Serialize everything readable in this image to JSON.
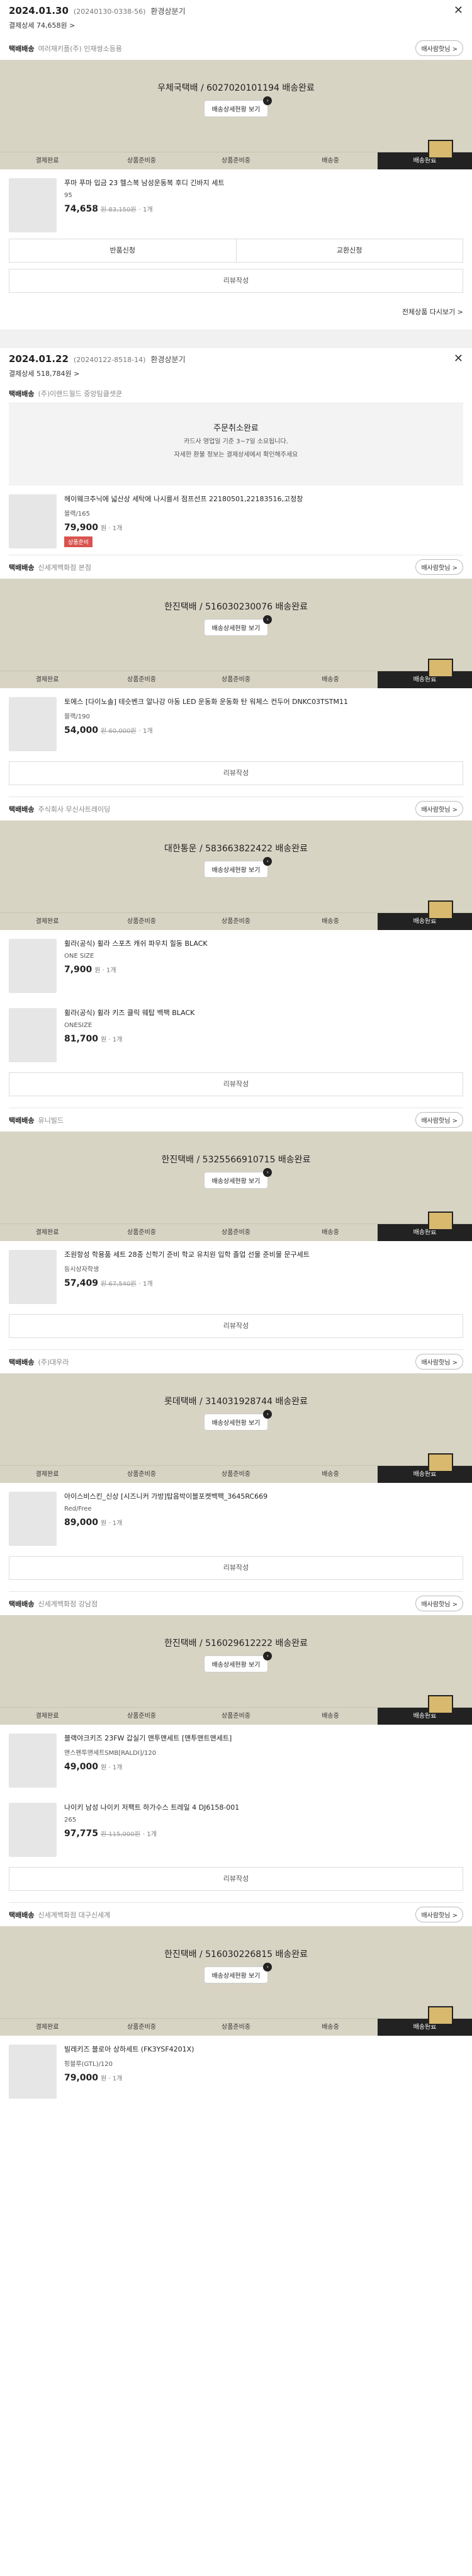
{
  "orders": [
    {
      "date": "2024.01.30",
      "order_no": "(20240130-0338-56)",
      "back": "환경상분기",
      "paysum": "결제상세 74,658원 >"
    },
    {
      "date": "2024.01.22",
      "order_no": "(20240122-8518-14)",
      "back": "환경상분기",
      "paysum": "결제상세 518,784원 >"
    }
  ],
  "groups": [
    {
      "label": "택배배송",
      "seller": "여러재키플(주) 인재쌍소등용",
      "q": "배사람핫님 >",
      "status": "우체국택배 / 6027020101194 배송완료",
      "track": "배송상세현황 보기",
      "product": {
        "name": "푸마 푸마 입금 23 헬스복 남성운동복 후디 긴바지 세트",
        "opt": "95",
        "price": "74,658",
        "orig": "원 83,150원",
        "qty": "· 1개"
      },
      "buttons": [
        "반품신청",
        "교환신청"
      ],
      "review": "리뷰작성",
      "all": "전체상품 다시보기 >"
    },
    {
      "label": "택배배송",
      "seller": "(주)이랜드월드 중앙팀클셋쿤",
      "cancel": {
        "title": "주문취소완료",
        "desc1": "카드사 영업일 기준 3~7일 소요됩니다.",
        "desc2": "자세한 환불 정보는 결제상세에서 확인해주세요"
      },
      "product": {
        "name": "헤이웨크추닉에 넓산상 세탁에 나시를서 점프선프 22180501,22183516,고정창",
        "opt": "블랙/165",
        "price": "79,900",
        "qty": "원 · 1개",
        "badge": "상품준비"
      }
    },
    {
      "label": "택배배송",
      "seller": "신세계백화점 본점",
      "q": "배사람핫님 >",
      "status": "한진택배 / 516030230076 배송완료",
      "track": "배송상세현황 보기",
      "product": {
        "name": "토에스 [다이노솔] 테슷벤크 알나강 아동 LED 운동화 운동화 탄 워체스 컨두어 DNKC03TSTM11",
        "opt": "블랙/190",
        "price": "54,000",
        "orig": "원 60,000원",
        "qty": "· 1개"
      },
      "review": "리뷰작성"
    },
    {
      "label": "택배배송",
      "seller": "주식회사 무신사트레이딩",
      "q": "배사람핫님 >",
      "status": "대한통운 / 583663822422 배송완료",
      "track": "배송상세현황 보기",
      "products": [
        {
          "name": "휠라(공식) 휠라 스포츠 캐쉬 파우치 힐동 BLACK",
          "opt": "ONE SIZE",
          "price": "7,900",
          "qty": "원 · 1개"
        },
        {
          "name": "휠라(공식) 휠라 키즈 클릭 웨탑 백팩 BLACK",
          "opt": "ONESIZE",
          "price": "81,700",
          "qty": "원 · 1개"
        }
      ],
      "review": "리뷰작성"
    },
    {
      "label": "택배배송",
      "seller": "유니빌드",
      "q": "배사람핫님 >",
      "status": "한진택배 / 5325566910715 배송완료",
      "track": "배송상세현황 보기",
      "product": {
        "name": "조원항성 학용품 세트 28종 신학기 준비 학교 유치원 입학 졸업 선물 준비물 문구세트",
        "opt": "등시상자학생",
        "price": "57,409",
        "orig": "원 67,540원",
        "qty": "· 1개"
      },
      "review": "리뷰작성"
    },
    {
      "label": "택배배송",
      "seller": "(주)대우라",
      "q": "배사람핫님 >",
      "status": "롯데택배 / 314031928744 배송완료",
      "track": "배송상세현황 보기",
      "product": {
        "name": "아이스비스킨_신상 [시즈니커 가방]탑음박이블포켓백팩_3645RC669",
        "opt": "Red/Free",
        "price": "89,000",
        "qty": "원 · 1개"
      },
      "review": "리뷰작성"
    },
    {
      "label": "택배배송",
      "seller": "신세계백화점 강남점",
      "q": "배사람핫님 >",
      "status": "한진택배 / 516029612222 배송완료",
      "track": "배송상세현황 보기",
      "products": [
        {
          "name": "블랙야크키즈 23FW 갑실기 맨투맨세트 [맨투맨트맨세트]",
          "opt": "맨스펜투맨세트SMB[RALDI]/120",
          "price": "49,000",
          "qty": "원 · 1개"
        },
        {
          "name": "나이키 남성 나이키 저팩트 하가수스 트레일 4 DJ6158-001",
          "opt": "265",
          "price": "97,775",
          "orig": "원 115,000원",
          "qty": "· 1개"
        }
      ],
      "review": "리뷰작성"
    },
    {
      "label": "택배배송",
      "seller": "신세계백화점 대구신세계",
      "q": "배사람핫님 >",
      "status": "한진택배 / 516030226815 배송완료",
      "track": "배송상세현황 보기",
      "product": {
        "name": "빌레키즈 블로아 상하세트 (FK3YSF4201X)",
        "opt": "핑블루(GTL)/120",
        "price": "79,000",
        "qty": "원 · 1개"
      }
    }
  ],
  "steps": [
    "결제완료",
    "상품준비중",
    "상품준비중",
    "배송중",
    "배송완료"
  ],
  "colors": {
    "status_bg": "#d8d4c4",
    "active_step": "#222222",
    "badge": "#d9534f"
  }
}
